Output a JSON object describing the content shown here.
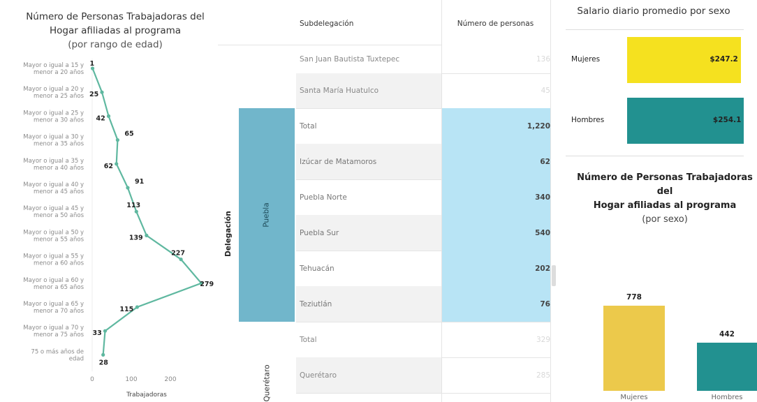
{
  "left_chart": {
    "title_line1": "Número de Personas Trabajadoras del",
    "title_line2": "Hogar afiliadas al programa",
    "subtitle": "(por rango de edad)"
  },
  "table": {
    "header_sub": "Subdelegación",
    "header_num": "Número de personas",
    "delegacion_label": "Delegación",
    "rows": [
      {
        "sub": "San Juan Bautista Tuxtepec",
        "num": "136",
        "faded": true
      },
      {
        "sub": "Santa María Huatulco",
        "num": "45",
        "faded": true
      },
      {
        "sub": "Total",
        "num": "1,220",
        "faded": false
      },
      {
        "sub": "Izúcar de Matamoros",
        "num": "62",
        "faded": false
      },
      {
        "sub": "Puebla Norte",
        "num": "340",
        "faded": false
      },
      {
        "sub": "Puebla Sur",
        "num": "540",
        "faded": false
      },
      {
        "sub": "Tehuacán",
        "num": "202",
        "faded": false
      },
      {
        "sub": "Teziutlán",
        "num": "76",
        "faded": false
      },
      {
        "sub": "Total",
        "num": "329",
        "faded": true
      },
      {
        "sub": "Querétaro",
        "num": "285",
        "faded": true
      }
    ],
    "group_puebla": "Puebla",
    "group_queretaro": "Querétaro"
  },
  "salary": {
    "title": "Salario diario promedio por sexo",
    "bars": [
      {
        "label": "Mujeres",
        "value_label": "$247.2",
        "value": 247.2,
        "color": "#f5e11f"
      },
      {
        "label": "Hombres",
        "value_label": "$254.1",
        "value": 254.1,
        "color": "#229190"
      }
    ]
  },
  "sex_chart": {
    "title_line1": "Número de Personas Trabajadoras del",
    "title_line2": "Hogar afiliadas al programa",
    "subtitle": "(por sexo)"
  },
  "colors": {
    "line": "#5fb8a0",
    "highlight": "#b8e4f5",
    "delegacion": "#71b6cb"
  },
  "chart_data": [
    {
      "type": "line",
      "orientation": "vertical-categories",
      "categories": [
        "Mayor o igual a 15 y menor a 20 años",
        "Mayor o igual a 20 y menor a 25 años",
        "Mayor o igual a 25 y menor a 30 años",
        "Mayor o igual a 30 y menor a 35 años",
        "Mayor o igual a 35 y menor a 40 años",
        "Mayor o igual a 40 y menor a 45 años",
        "Mayor o igual a 45 y menor a 50 años",
        "Mayor o igual a 50 y menor a 55 años",
        "Mayor o igual a 55 y menor a 60 años",
        "Mayor o igual a 60 y menor a 65 años",
        "Mayor o igual a 65 y menor a 70 años",
        "Mayor o igual a 70 y menor a 75 años",
        "75 o más años de edad"
      ],
      "values": [
        1,
        25,
        42,
        65,
        62,
        91,
        113,
        139,
        227,
        279,
        115,
        33,
        28
      ],
      "xlabel": "Trabajadoras",
      "xticks": [
        0,
        100,
        200
      ],
      "xlim": [
        0,
        279
      ]
    },
    {
      "type": "bar",
      "orientation": "horizontal",
      "categories": [
        "Mujeres",
        "Hombres"
      ],
      "values": [
        247.2,
        254.1
      ],
      "value_labels": [
        "$247.2",
        "$254.1"
      ],
      "title": "Salario diario promedio por sexo"
    },
    {
      "type": "bar",
      "orientation": "vertical",
      "categories": [
        "Mujeres",
        "Hombres"
      ],
      "values": [
        778,
        442
      ],
      "colors": [
        "#ecc94b",
        "#229190"
      ],
      "title": "Número de Personas Trabajadoras del Hogar afiliadas al programa (por sexo)"
    }
  ]
}
